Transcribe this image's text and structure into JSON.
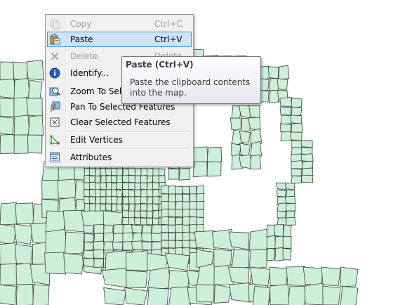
{
  "map": {
    "fill_color": "#cdefd9",
    "line_color": "#3a3a3a",
    "background": "#ffffff"
  },
  "context_menu": {
    "items": [
      {
        "label": "Copy",
        "shortcut": "Ctrl+C",
        "icon": "copy-icon",
        "enabled": false
      },
      {
        "label": "Paste",
        "shortcut": "Ctrl+V",
        "icon": "paste-icon",
        "enabled": true,
        "highlighted": true
      },
      {
        "label": "Delete",
        "shortcut": "Delete",
        "icon": "delete-icon",
        "enabled": false
      },
      {
        "label": "Identify...",
        "shortcut": "",
        "icon": "info-icon",
        "enabled": true
      },
      {
        "label": "Zoom To Selected Features",
        "shortcut": "",
        "icon": "zoom-to-selected-icon",
        "enabled": true
      },
      {
        "label": "Pan To Selected Features",
        "shortcut": "",
        "icon": "pan-to-selected-icon",
        "enabled": true
      },
      {
        "label": "Clear Selected Features",
        "shortcut": "",
        "icon": "clear-selection-icon",
        "enabled": true
      },
      {
        "label": "Edit Vertices",
        "shortcut": "",
        "icon": "edit-vertices-icon",
        "enabled": true
      },
      {
        "label": "Attributes",
        "shortcut": "",
        "icon": "attributes-icon",
        "enabled": true
      }
    ]
  },
  "tooltip": {
    "title": "Paste (Ctrl+V)",
    "description": "Paste the clipboard contents into the map."
  }
}
